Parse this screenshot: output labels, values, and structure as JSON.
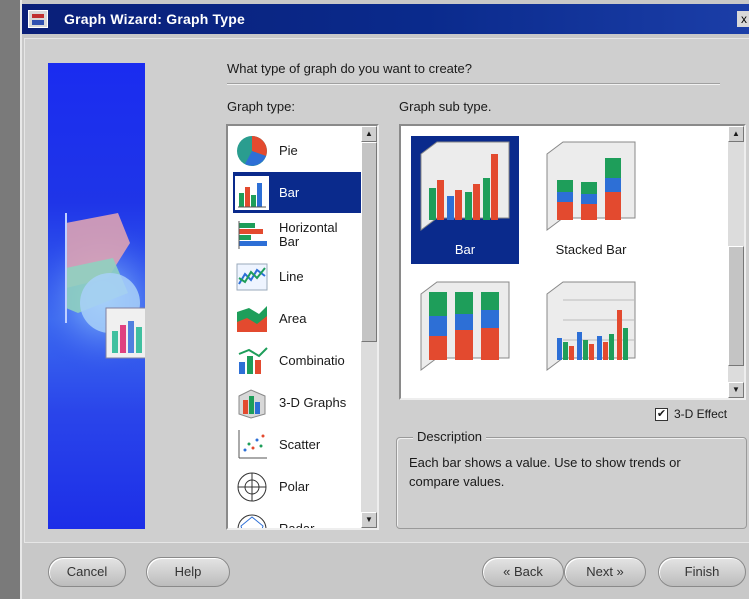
{
  "window": {
    "title": "Graph Wizard: Graph Type",
    "close_glyph": "x"
  },
  "question": "What type of graph do you want to create?",
  "graph_type": {
    "label": "Graph type:",
    "items": [
      {
        "label": "Pie",
        "icon": "pie-icon"
      },
      {
        "label": "Bar",
        "icon": "bar-icon",
        "selected": true
      },
      {
        "label": "Horizontal Bar",
        "icon": "horizontal-bar-icon"
      },
      {
        "label": "Line",
        "icon": "line-icon"
      },
      {
        "label": "Area",
        "icon": "area-icon"
      },
      {
        "label": "Combinatio",
        "icon": "combination-icon"
      },
      {
        "label": "3-D Graphs",
        "icon": "3d-graphs-icon"
      },
      {
        "label": "Scatter",
        "icon": "scatter-icon"
      },
      {
        "label": "Polar",
        "icon": "polar-icon"
      },
      {
        "label": "Radar",
        "icon": "radar-icon"
      }
    ]
  },
  "graph_sub_type": {
    "label": "Graph sub type.",
    "items": [
      {
        "label": "Bar",
        "selected": true,
        "icon": "3d-bar-icon"
      },
      {
        "label": "Stacked Bar",
        "icon": "stacked-bar-icon"
      },
      {
        "label": "",
        "icon": "percent-stacked-bar-icon"
      },
      {
        "label": "",
        "icon": "3d-clustered-bar-icon"
      }
    ]
  },
  "effect_3d": {
    "label": "3-D Effect",
    "checked": true
  },
  "description": {
    "legend": "Description",
    "text": "Each bar shows a value. Use to show trends or compare values."
  },
  "buttons": {
    "cancel": "Cancel",
    "help": "Help",
    "back": "Back",
    "next": "Next",
    "finish": "Finish"
  },
  "colors": {
    "title_bar": "#0a2a8c",
    "selection": "#0a2a8c",
    "panel": "#cfcfcf",
    "art_blue": "#1f35e8"
  }
}
